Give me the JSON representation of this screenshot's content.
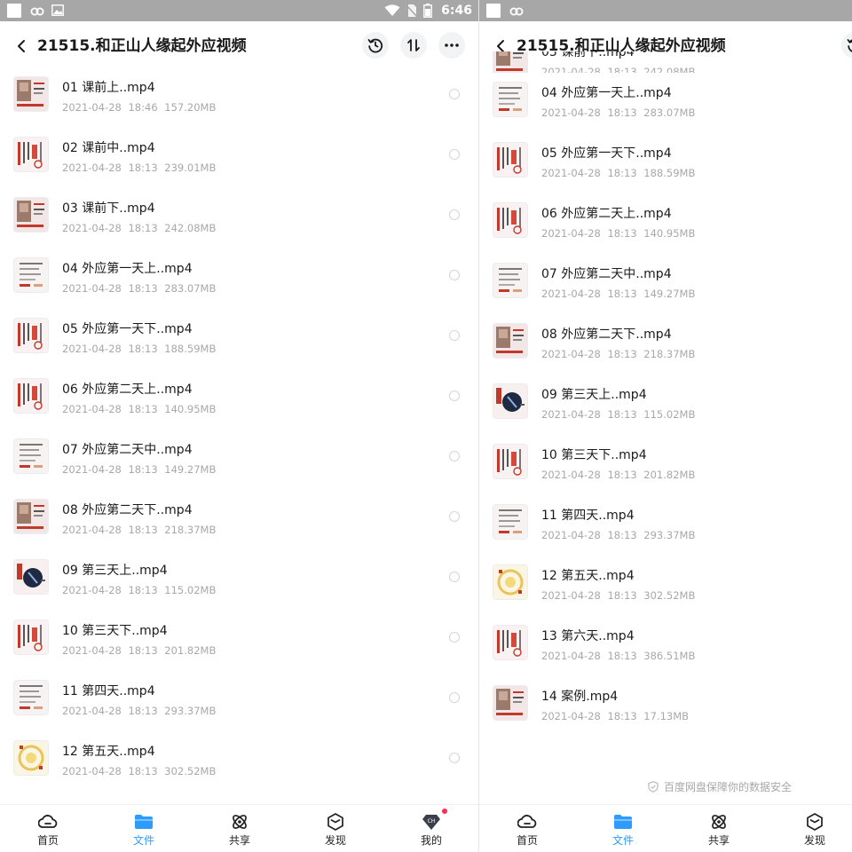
{
  "status_bar": {
    "time": "6:46"
  },
  "header": {
    "title": "21515.和正山人缘起外应视频"
  },
  "files": [
    {
      "name": "01 课前上..mp4",
      "date": "2021-04-28",
      "time": "18:46",
      "size": "157.20MB",
      "thumb": "photo"
    },
    {
      "name": "02 课前中..mp4",
      "date": "2021-04-28",
      "time": "18:13",
      "size": "239.01MB",
      "thumb": "text-red"
    },
    {
      "name": "03 课前下..mp4",
      "date": "2021-04-28",
      "time": "18:13",
      "size": "242.08MB",
      "thumb": "photo"
    },
    {
      "name": "04 外应第一天上..mp4",
      "date": "2021-04-28",
      "time": "18:13",
      "size": "283.07MB",
      "thumb": "text"
    },
    {
      "name": "05 外应第一天下..mp4",
      "date": "2021-04-28",
      "time": "18:13",
      "size": "188.59MB",
      "thumb": "text-red"
    },
    {
      "name": "06 外应第二天上..mp4",
      "date": "2021-04-28",
      "time": "18:13",
      "size": "140.95MB",
      "thumb": "text-red"
    },
    {
      "name": "07 外应第二天中..mp4",
      "date": "2021-04-28",
      "time": "18:13",
      "size": "149.27MB",
      "thumb": "text"
    },
    {
      "name": "08 外应第二天下..mp4",
      "date": "2021-04-28",
      "time": "18:13",
      "size": "218.37MB",
      "thumb": "photo"
    },
    {
      "name": "09 第三天上..mp4",
      "date": "2021-04-28",
      "time": "18:13",
      "size": "115.02MB",
      "thumb": "dark"
    },
    {
      "name": "10 第三天下..mp4",
      "date": "2021-04-28",
      "time": "18:13",
      "size": "201.82MB",
      "thumb": "text-red"
    },
    {
      "name": "11 第四天..mp4",
      "date": "2021-04-28",
      "time": "18:13",
      "size": "293.37MB",
      "thumb": "text"
    },
    {
      "name": "12 第五天..mp4",
      "date": "2021-04-28",
      "time": "18:13",
      "size": "302.52MB",
      "thumb": "yellow"
    },
    {
      "name": "13 第六天..mp4",
      "date": "2021-04-28",
      "time": "18:13",
      "size": "386.51MB",
      "thumb": "text-red"
    },
    {
      "name": "14 案例.mp4",
      "date": "2021-04-28",
      "time": "18:13",
      "size": "17.13MB",
      "thumb": "photo"
    }
  ],
  "footer_note": "百度网盘保障你的数据安全",
  "nav": [
    {
      "id": "home",
      "label": "首页",
      "icon": "cloud-icon"
    },
    {
      "id": "files",
      "label": "文件",
      "icon": "folder-icon",
      "active": true
    },
    {
      "id": "share",
      "label": "共享",
      "icon": "share-icon"
    },
    {
      "id": "discover",
      "label": "发现",
      "icon": "discover-cube-icon"
    },
    {
      "id": "mine",
      "label": "我的",
      "icon": "vip-gem-icon",
      "badge": true
    }
  ],
  "colors": {
    "accent": "#2d9bff",
    "status_bar": "#a7a7a7",
    "meta_text": "#a8a8a8",
    "badge": "#ff2d55"
  }
}
